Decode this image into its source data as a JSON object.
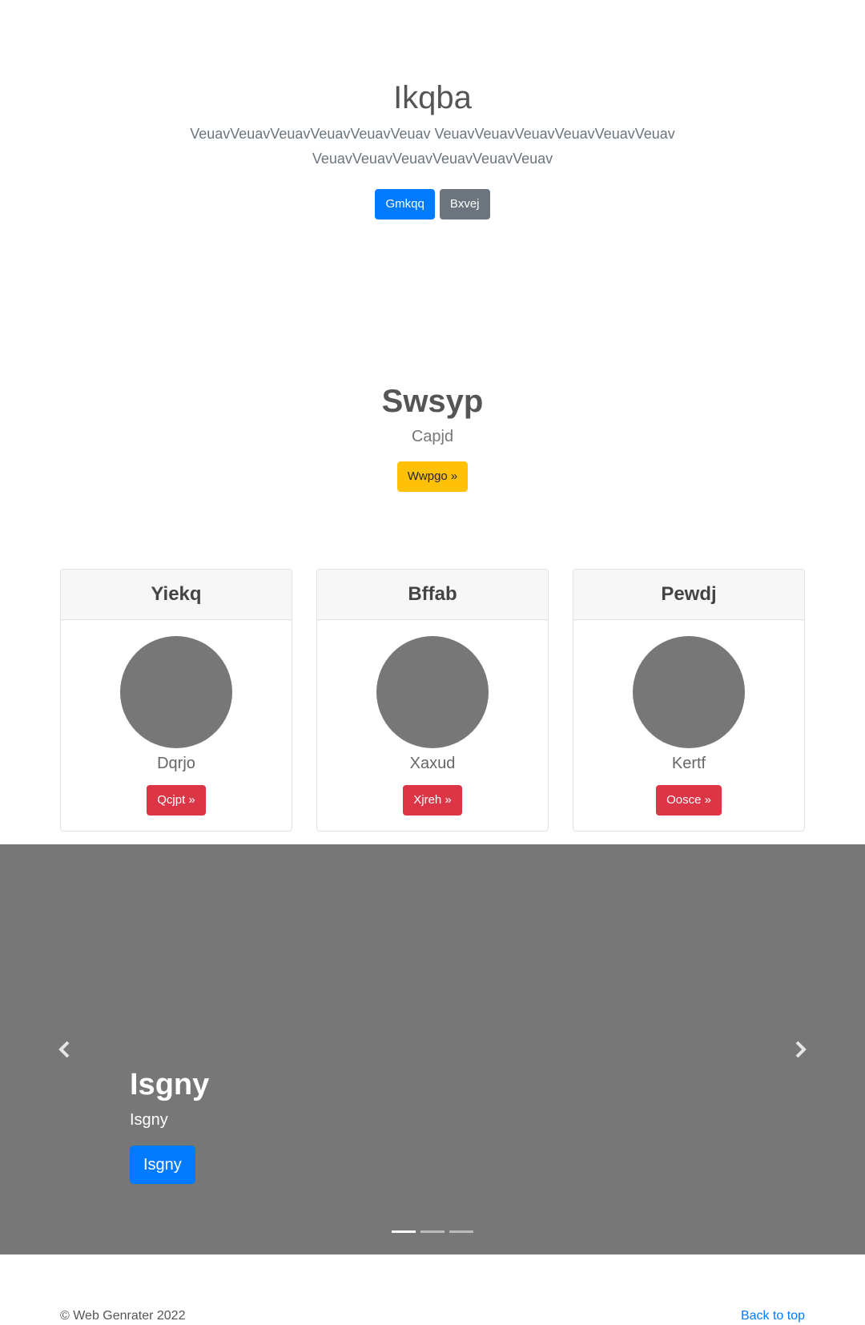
{
  "hero": {
    "title": "Ikqba",
    "lead": "VeuavVeuavVeuavVeuavVeuavVeuav VeuavVeuavVeuavVeuavVeuavVeuav VeuavVeuavVeuavVeuavVeuavVeuav",
    "primary_button": "Gmkqq",
    "secondary_button": "Bxvej"
  },
  "section": {
    "title": "Swsyp",
    "subtitle": "Capjd",
    "cta_button": "Wwpgo »"
  },
  "cards": [
    {
      "header": "Yiekq",
      "text": "Dqrjo",
      "button": "Qcjpt »"
    },
    {
      "header": "Bffab",
      "text": "Xaxud",
      "button": "Xjreh »"
    },
    {
      "header": "Pewdj",
      "text": "Kertf",
      "button": "Oosce »"
    }
  ],
  "carousel": {
    "caption_title": "Isgny",
    "caption_text": "Isgny",
    "caption_button": "Isgny",
    "prev_icon": "chevron-left-icon",
    "next_icon": "chevron-right-icon",
    "slide_count": 3,
    "active_slide": 1
  },
  "footer": {
    "copyright": "© Web Genrater 2022",
    "back_to_top": "Back to top"
  },
  "colors": {
    "primary": "#007bff",
    "secondary": "#6c757d",
    "warning": "#ffc107",
    "danger": "#dc3545",
    "carousel_bg": "#777777"
  }
}
